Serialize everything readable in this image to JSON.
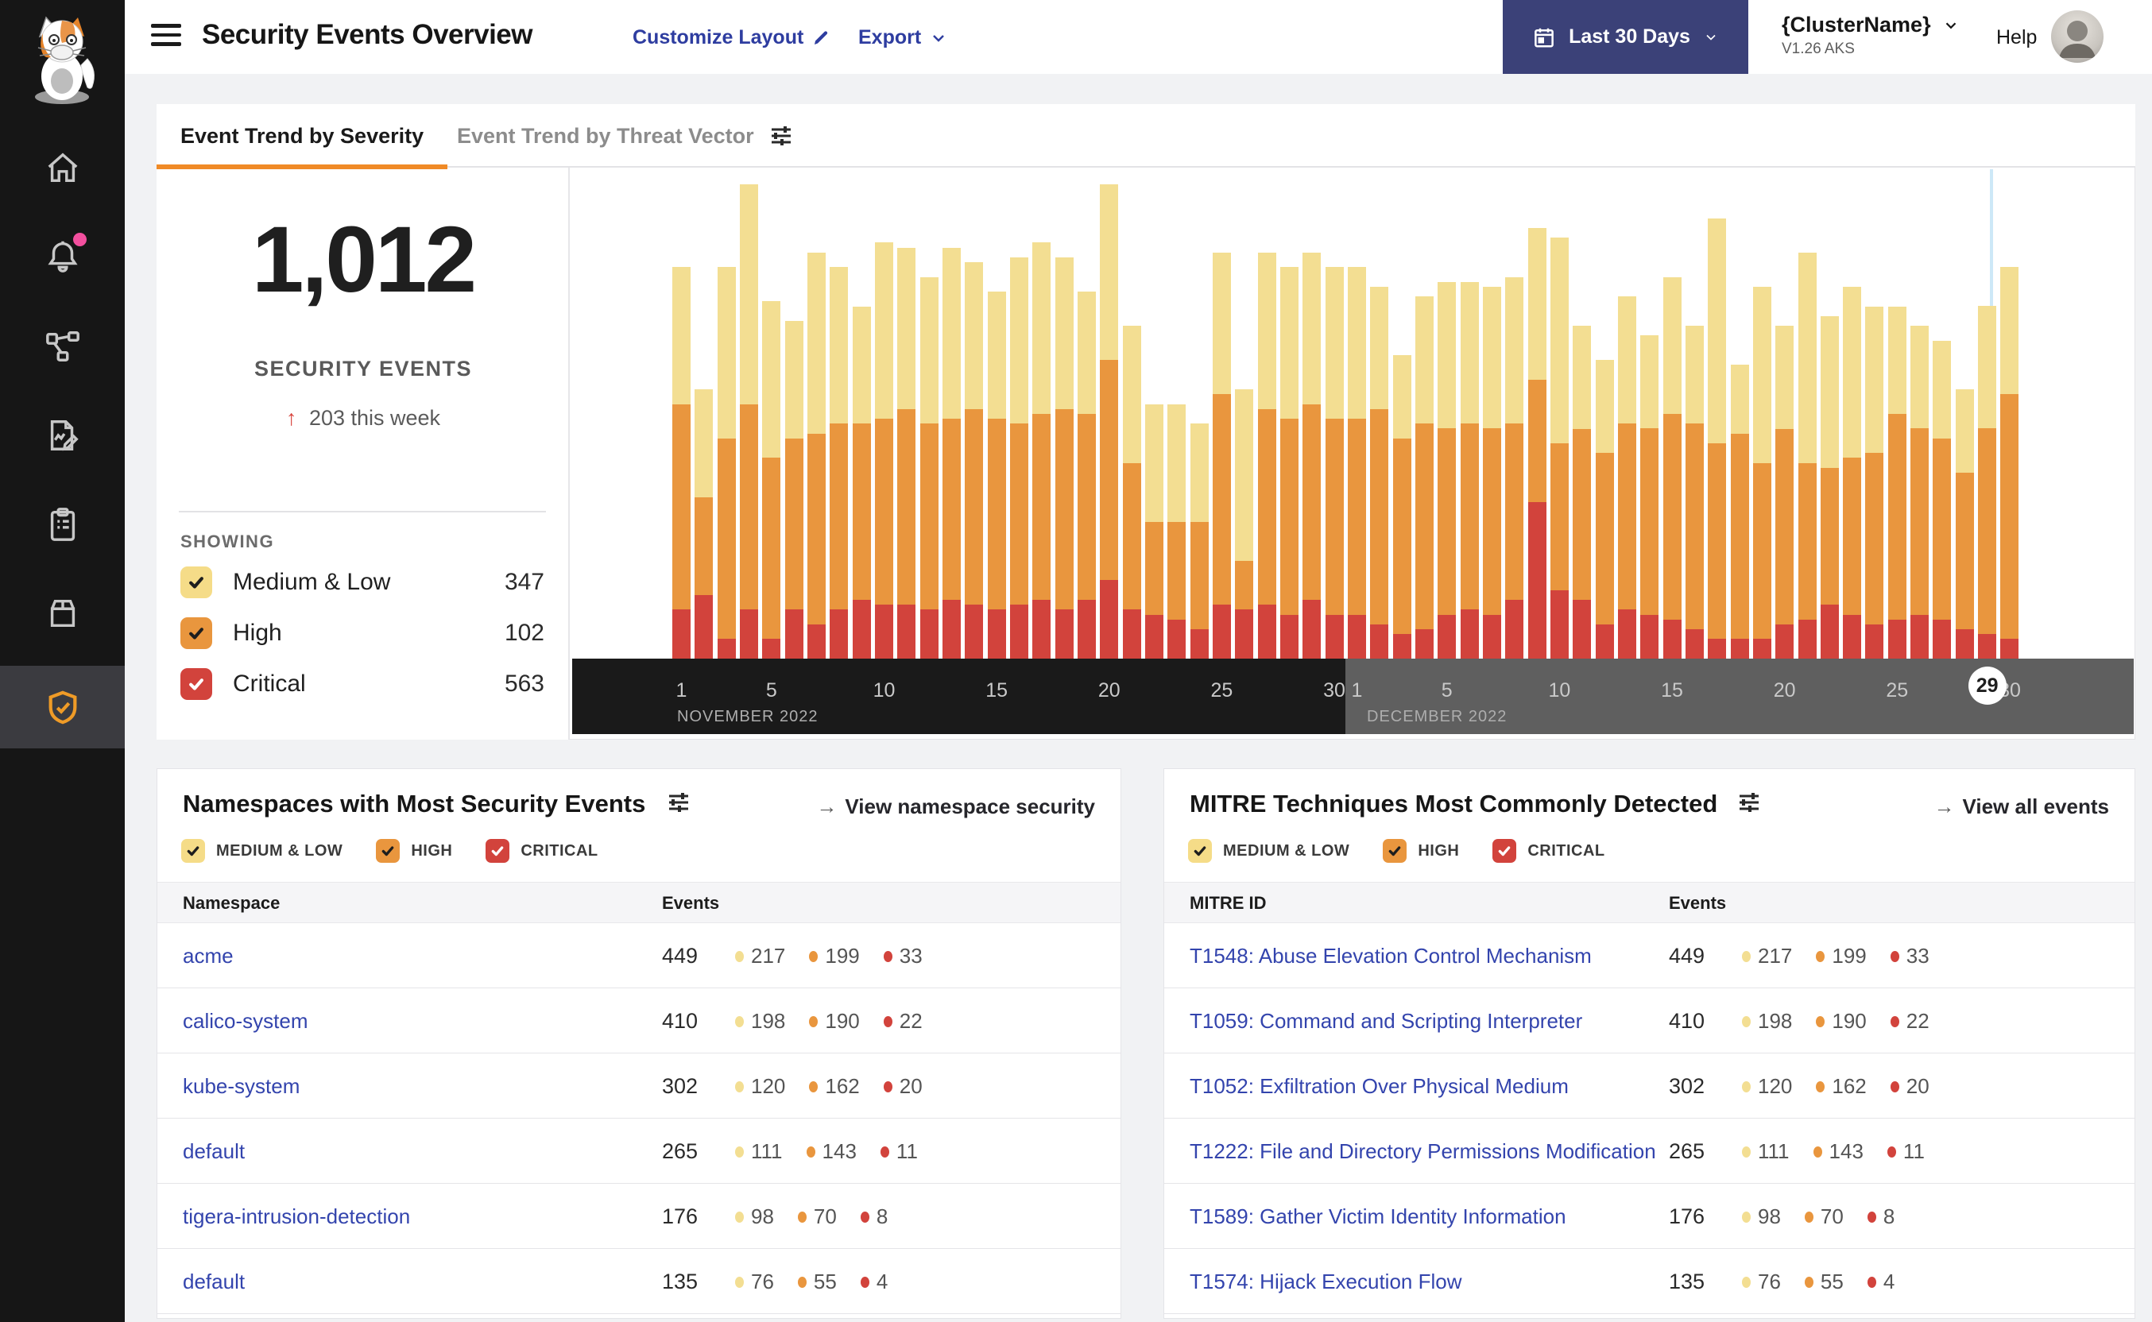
{
  "colors": {
    "accent_orange": "#F08A26",
    "severity_medium_low": "#F3DE92",
    "severity_high": "#E9963E",
    "severity_critical": "#D2433C",
    "link_indigo": "#3344AD",
    "header_link": "#2E3DA0",
    "date_button_bg": "#3B4178",
    "notification_pink": "#F34F9E",
    "shield_active": "#EF9B27",
    "selected_day_line": "#CDE8F7",
    "axis_november_bg": "#1A1A1A",
    "axis_december_bg": "#5F5F5F"
  },
  "sidebar": {
    "logo": "calico-cat-logo",
    "icons": [
      "home",
      "bell-with-notification-dot",
      "service-graph-nodes",
      "report-pencil-document",
      "clipboard-list",
      "package-box",
      "shield-check-active"
    ]
  },
  "header": {
    "title": "Security Events Overview",
    "customize_label": "Customize Layout",
    "export_label": "Export",
    "date_range": "Last 30 Days",
    "cluster_name": "{ClusterName}",
    "cluster_version": "V1.26 AKS",
    "help_label": "Help"
  },
  "trend": {
    "tabs": [
      {
        "label": "Event Trend by Severity",
        "active": true
      },
      {
        "label": "Event Trend by Threat Vector",
        "active": false
      }
    ],
    "summary": {
      "total": "1,012",
      "label": "SECURITY EVENTS",
      "delta_arrow": "↑",
      "delta": "203 this week"
    },
    "showing": {
      "label": "SHOWING",
      "items": [
        {
          "label": "Medium & Low",
          "count": "347"
        },
        {
          "label": "High",
          "count": "102"
        },
        {
          "label": "Critical",
          "count": "563"
        }
      ]
    }
  },
  "severity_filters": [
    {
      "label": "MEDIUM & LOW"
    },
    {
      "label": "HIGH"
    },
    {
      "label": "CRITICAL"
    }
  ],
  "chart_data": {
    "type": "bar",
    "stacked": true,
    "title": "",
    "xlabel": "",
    "ylabel": "",
    "y_axis_note": "no y-axis labels shown; values are estimated percent of plot height",
    "x_axis": {
      "nov_label": "NOVEMBER 2022",
      "dec_label": "DECEMBER 2022",
      "nov_ticks": [
        1,
        5,
        10,
        15,
        20,
        25,
        30
      ],
      "dec_ticks": [
        1,
        5,
        10,
        15,
        20,
        25,
        30
      ],
      "selected_day_dec": 29
    },
    "categories": [
      "Nov 1",
      "Nov 2",
      "Nov 3",
      "Nov 4",
      "Nov 5",
      "Nov 6",
      "Nov 7",
      "Nov 8",
      "Nov 9",
      "Nov 10",
      "Nov 11",
      "Nov 12",
      "Nov 13",
      "Nov 14",
      "Nov 15",
      "Nov 16",
      "Nov 17",
      "Nov 18",
      "Nov 19",
      "Nov 20",
      "Nov 21",
      "Nov 22",
      "Nov 23",
      "Nov 24",
      "Nov 25",
      "Nov 26",
      "Nov 27",
      "Nov 28",
      "Nov 29",
      "Nov 30",
      "Dec 1",
      "Dec 2",
      "Dec 3",
      "Dec 4",
      "Dec 5",
      "Dec 6",
      "Dec 7",
      "Dec 8",
      "Dec 9",
      "Dec 10",
      "Dec 11",
      "Dec 12",
      "Dec 13",
      "Dec 14",
      "Dec 15",
      "Dec 16",
      "Dec 17",
      "Dec 18",
      "Dec 19",
      "Dec 20",
      "Dec 21",
      "Dec 22",
      "Dec 23",
      "Dec 24",
      "Dec 25",
      "Dec 26",
      "Dec 27",
      "Dec 28",
      "Dec 29",
      "Dec 30"
    ],
    "series": [
      {
        "name": "Medium & Low",
        "color": "#F3DE92",
        "values": [
          28,
          22,
          35,
          45,
          32,
          24,
          37,
          32,
          24,
          36,
          33,
          30,
          35,
          30,
          26,
          34,
          35,
          31,
          25,
          36,
          28,
          24,
          24,
          20,
          29,
          35,
          32,
          31,
          31,
          31,
          31,
          25,
          17,
          26,
          30,
          29,
          29,
          30,
          31,
          42,
          21,
          19,
          26,
          19,
          28,
          20,
          46,
          14,
          36,
          21,
          43,
          31,
          35,
          30,
          22,
          21,
          20,
          17,
          25,
          26
        ]
      },
      {
        "name": "High",
        "color": "#E9963E",
        "values": [
          42,
          20,
          41,
          42,
          37,
          35,
          39,
          38,
          36,
          38,
          40,
          38,
          37,
          40,
          39,
          37,
          38,
          41,
          38,
          45,
          30,
          19,
          20,
          22,
          43,
          10,
          40,
          40,
          40,
          40,
          40,
          44,
          40,
          42,
          38,
          38,
          38,
          36,
          25,
          30,
          35,
          35,
          38,
          38,
          42,
          42,
          40,
          42,
          36,
          40,
          32,
          28,
          32,
          35,
          42,
          38,
          37,
          32,
          42,
          50
        ]
      },
      {
        "name": "Critical",
        "color": "#D2433C",
        "values": [
          10,
          13,
          4,
          10,
          4,
          10,
          7,
          10,
          12,
          11,
          11,
          10,
          12,
          11,
          10,
          11,
          12,
          10,
          12,
          16,
          10,
          9,
          8,
          6,
          11,
          10,
          11,
          9,
          12,
          9,
          9,
          7,
          5,
          6,
          9,
          10,
          9,
          12,
          32,
          14,
          12,
          7,
          10,
          9,
          8,
          6,
          4,
          4,
          4,
          7,
          8,
          11,
          9,
          7,
          8,
          9,
          8,
          6,
          5,
          4
        ]
      }
    ]
  },
  "namespaces": {
    "title": "Namespaces with Most Security Events",
    "link_label": "View namespace security",
    "link_arrow": "→",
    "columns": [
      "Namespace",
      "Events"
    ],
    "rows": [
      {
        "label": "acme",
        "total": "449",
        "medium_low": "217",
        "high": "199",
        "critical": "33"
      },
      {
        "label": "calico-system",
        "total": "410",
        "medium_low": "198",
        "high": "190",
        "critical": "22"
      },
      {
        "label": "kube-system",
        "total": "302",
        "medium_low": "120",
        "high": "162",
        "critical": "20"
      },
      {
        "label": "default",
        "total": "265",
        "medium_low": "111",
        "high": "143",
        "critical": "11"
      },
      {
        "label": "tigera-intrusion-detection",
        "total": "176",
        "medium_low": "98",
        "high": "70",
        "critical": "8"
      },
      {
        "label": "default",
        "total": "135",
        "medium_low": "76",
        "high": "55",
        "critical": "4"
      }
    ]
  },
  "mitre": {
    "title": "MITRE Techniques Most Commonly Detected",
    "link_label": "View all events",
    "link_arrow": "→",
    "columns": [
      "MITRE ID",
      "Events"
    ],
    "rows": [
      {
        "label": "T1548: Abuse Elevation Control Mechanism",
        "total": "449",
        "medium_low": "217",
        "high": "199",
        "critical": "33"
      },
      {
        "label": "T1059: Command and Scripting Interpreter",
        "total": "410",
        "medium_low": "198",
        "high": "190",
        "critical": "22"
      },
      {
        "label": "T1052: Exfiltration Over Physical Medium",
        "total": "302",
        "medium_low": "120",
        "high": "162",
        "critical": "20"
      },
      {
        "label": "T1222: File and Directory Permissions Modification",
        "total": "265",
        "medium_low": "111",
        "high": "143",
        "critical": "11"
      },
      {
        "label": "T1589: Gather Victim Identity Information",
        "total": "176",
        "medium_low": "98",
        "high": "70",
        "critical": "8"
      },
      {
        "label": "T1574: Hijack Execution Flow",
        "total": "135",
        "medium_low": "76",
        "high": "55",
        "critical": "4"
      }
    ]
  }
}
